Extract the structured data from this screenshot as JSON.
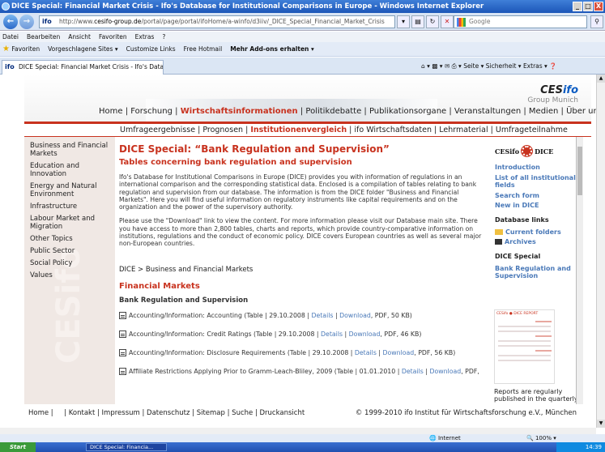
{
  "window": {
    "title": "DICE Special: Financial Market Crisis - Ifo's Database for Institutional Comparisons in Europe - Windows Internet Explorer",
    "controls": [
      "_",
      "□",
      "X"
    ]
  },
  "addressbar": {
    "url_prefix": "http://www.",
    "url_domain": "cesifo-group.de",
    "url_path": "/portal/page/portal/ifoHome/a-winfo/d3iiv/_DICE_Special_Financial_Market_Crisis",
    "site_icon": "ifo",
    "search_placeholder": "Google"
  },
  "menubar": [
    "Datei",
    "Bearbeiten",
    "Ansicht",
    "Favoriten",
    "Extras",
    "?"
  ],
  "favorites": [
    "Favoriten",
    "Vorgeschlagene Sites ▾",
    "Customize Links",
    "Free Hotmail",
    "Mehr Add-ons erhalten ▾"
  ],
  "tab": {
    "label": "DICE Special: Financial Market Crisis - Ifo's Database f..."
  },
  "commandbar": "Seite ▾  Sicherheit ▾  Extras ▾",
  "site": {
    "logo_main": "CES",
    "logo_accent": "ifo",
    "logo_sub": "Group Munich",
    "mainnav": [
      {
        "label": "Home",
        "active": false
      },
      {
        "label": "Forschung",
        "active": false
      },
      {
        "label": "Wirtschaftsinformationen",
        "active": true
      },
      {
        "label": "Politikdebatte",
        "active": false
      },
      {
        "label": "Publikationsorgane",
        "active": false
      },
      {
        "label": "Veranstaltungen",
        "active": false
      },
      {
        "label": "Medien",
        "active": false
      },
      {
        "label": "Über uns",
        "active": false
      }
    ],
    "subnav": [
      {
        "label": "Umfrageergebnisse",
        "active": false
      },
      {
        "label": "Prognosen",
        "active": false
      },
      {
        "label": "Institutionenvergleich",
        "active": true
      },
      {
        "label": "ifo Wirtschaftsdaten",
        "active": false
      },
      {
        "label": "Lehrmaterial",
        "active": false
      },
      {
        "label": "Umfrageteilnahme",
        "active": false
      }
    ],
    "sidebar": [
      "Business and Financial Markets",
      "Education and Innovation",
      "Energy and Natural Environment",
      "Infrastructure",
      "Labour Market and Migration",
      "Other Topics",
      "Public Sector",
      "Social Policy",
      "Values"
    ],
    "sidebar_watermark": "CESifo DICE"
  },
  "content": {
    "title": "DICE Special: “Bank Regulation and Supervision”",
    "subtitle": "Tables concerning bank regulation and supervision",
    "para1": "Ifo's Database for Institutional Comparisons in Europe (DICE) provides you with information of regulations in an international comparison and the corresponding statistical data. Enclosed is a compilation of tables relating to bank regulation and supervision from our database. The information is from the DICE folder \"Business and Financial Markets\". Here you will find useful information on regulatory instruments like capital requirements and on the organization and the power of the supervisory authority.",
    "para2": "Please use the \"Download\" link to view the content. For more information please visit our Database main site. There you have access to more than 2,800 tables, charts and reports, which provide country-comparative information on institutions, regulations and the conduct of economic policy. DICE covers European countries as well as several major non-European countries.",
    "breadcrumb": "DICE > Business and Financial Markets",
    "section": "Financial Markets",
    "subsection": "Bank Regulation and Supervision",
    "docs": [
      {
        "text": "Accounting/Information: Accounting (Table | 29.10.2008 | ",
        "details": "Details",
        "download": "Download",
        "tail": ", PDF, 50 KB)"
      },
      {
        "text": "Accounting/Information: Credit Ratings (Table | 29.10.2008 | ",
        "details": "Details",
        "download": "Download",
        "tail": ", PDF, 46 KB)"
      },
      {
        "text": "Accounting/Information: Disclosure Requirements (Table | 29.10.2008 | ",
        "details": "Details",
        "download": "Download",
        "tail": ", PDF, 56 KB)"
      },
      {
        "text": "Affiliate Restrictions Applying Prior to Gramm-Leach-Bliley, 2009 (Table | 01.01.2010 | ",
        "details": "Details",
        "download": "Download",
        "tail": ", PDF,"
      }
    ]
  },
  "rightcol": {
    "header_left": "CESifo",
    "header_right": "DICE",
    "links": [
      "Introduction",
      "List of all institutional fields",
      "Search form",
      "New in DICE"
    ],
    "dblinks_title": "Database links",
    "dblinks": [
      "Current folders",
      "Archives"
    ],
    "special_title": "DICE Special",
    "special_link": "Bank Regulation and Supervision",
    "report_label": "CESifo ● DICE REPORT",
    "note": "Reports are regularly published in the quarterly"
  },
  "footer": {
    "left": "Home |     | Kontakt | Impressum | Datenschutz | Sitemap | Suche | Druckansicht",
    "right": "© 1999-2010 ifo Institut für Wirtschaftsforschung e.V., München"
  },
  "statusbar": {
    "zone": "Internet",
    "zoom": "100%"
  },
  "taskbar": {
    "start": "Start",
    "item": "DICE Special: Financia...",
    "time": "14:39"
  }
}
